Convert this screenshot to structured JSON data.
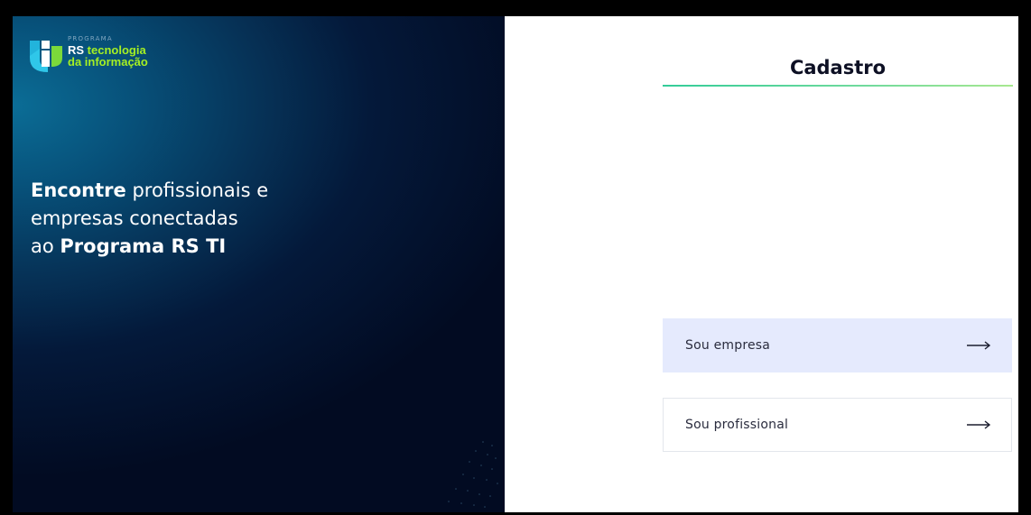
{
  "brand": {
    "small_label": "PROGRAMA",
    "line1_rs": "RS",
    "line1_rest": " tecnologia",
    "line2": "da informação"
  },
  "hero": {
    "line1_bold": "Encontre",
    "line1_rest": " profissionais e",
    "line2": "empresas conectadas",
    "line3_pre": "ao ",
    "line3_bold": "Programa RS TI"
  },
  "signup": {
    "title": "Cadastro",
    "options": [
      {
        "label": "Sou empresa",
        "icon": "arrow-right-icon"
      },
      {
        "label": "Sou profissional",
        "icon": "arrow-right-icon"
      }
    ]
  },
  "colors": {
    "brand_green": "#a5f023",
    "hero_dark": "#020b22",
    "hero_blue": "#0b6d96",
    "selected_option_bg": "#e5eafd",
    "title_rule_start": "#33cc99",
    "title_rule_end": "#a8e890"
  }
}
